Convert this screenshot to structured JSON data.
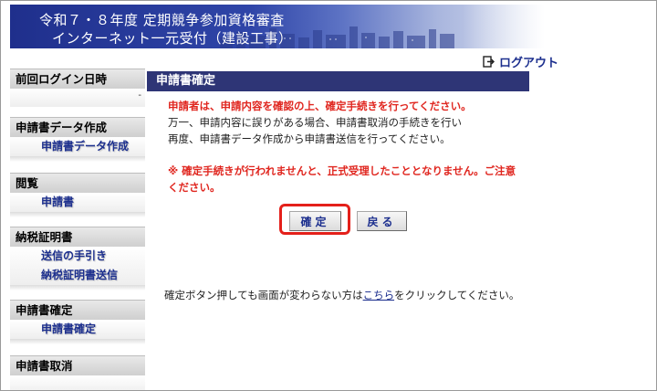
{
  "header": {
    "line1": "令和７・８年度 定期競争参加資格審査",
    "line2": "インターネット一元受付（建設工事）"
  },
  "logout_label": "ログアウト",
  "sidebar": {
    "last_login": {
      "heading": "前回ログイン日時",
      "value": "-"
    },
    "sections": [
      {
        "heading": "申請書データ作成",
        "items": [
          "申請書データ作成"
        ]
      },
      {
        "heading": "閲覧",
        "items": [
          "申請書"
        ]
      },
      {
        "heading": "納税証明書",
        "items": [
          "送信の手引き",
          "納税証明書送信"
        ]
      },
      {
        "heading": "申請書確定",
        "items": [
          "申請書確定"
        ]
      },
      {
        "heading": "申請書取消",
        "items": []
      }
    ]
  },
  "main": {
    "title": "申請書確定",
    "line1": "申請者は、申請内容を確認の上、確定手続きを行ってください。",
    "line2": "万一、申請内容に誤りがある場合、申請書取消の手続きを行い",
    "line3": "再度、申請書データ作成から申請書送信を行ってください。",
    "warning1": "※ 確定手続きが行われませんと、正式受理したこととなりません。ご注意",
    "warning2": "ください。",
    "confirm_button": "確定",
    "back_button": "戻る",
    "note_before": "確定ボタン押しても画面が変わらない方は",
    "note_link": "こちら",
    "note_after": "をクリックしてください。"
  },
  "colors": {
    "accent": "#2e3576",
    "link": "#1c2f8e",
    "warning": "#e0261f",
    "highlight": "#e4201a"
  }
}
